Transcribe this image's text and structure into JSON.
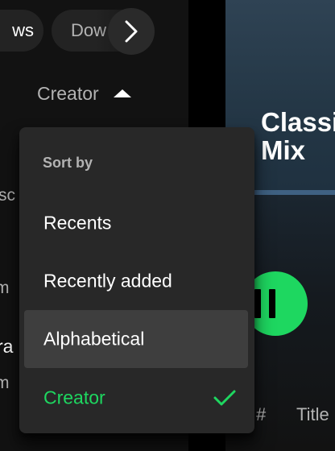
{
  "library": {
    "filter_chips": [
      "ws",
      "Dow"
    ],
    "sort_toggle_label": "Creator",
    "list_snippets": [
      "sc",
      "m",
      "ra",
      "m"
    ]
  },
  "playlist": {
    "title": "Classi\nMix",
    "header_color": "#2f4354",
    "columns": [
      "#",
      "Title"
    ]
  },
  "sort_menu": {
    "heading": "Sort by",
    "options": [
      {
        "label": "Recents",
        "state": "normal"
      },
      {
        "label": "Recently added",
        "state": "normal"
      },
      {
        "label": "Alphabetical",
        "state": "hover"
      },
      {
        "label": "Creator",
        "state": "selected"
      }
    ]
  },
  "colors": {
    "accent": "#1ed760",
    "menu_bg": "#282828",
    "hover_bg": "#3e3e3e",
    "app_bg": "#121212"
  },
  "icons": {
    "scroll_right": "chevron-right-icon",
    "sort_direction": "caret-up-icon",
    "play_state": "pause-icon",
    "selected_option": "checkmark-icon"
  }
}
